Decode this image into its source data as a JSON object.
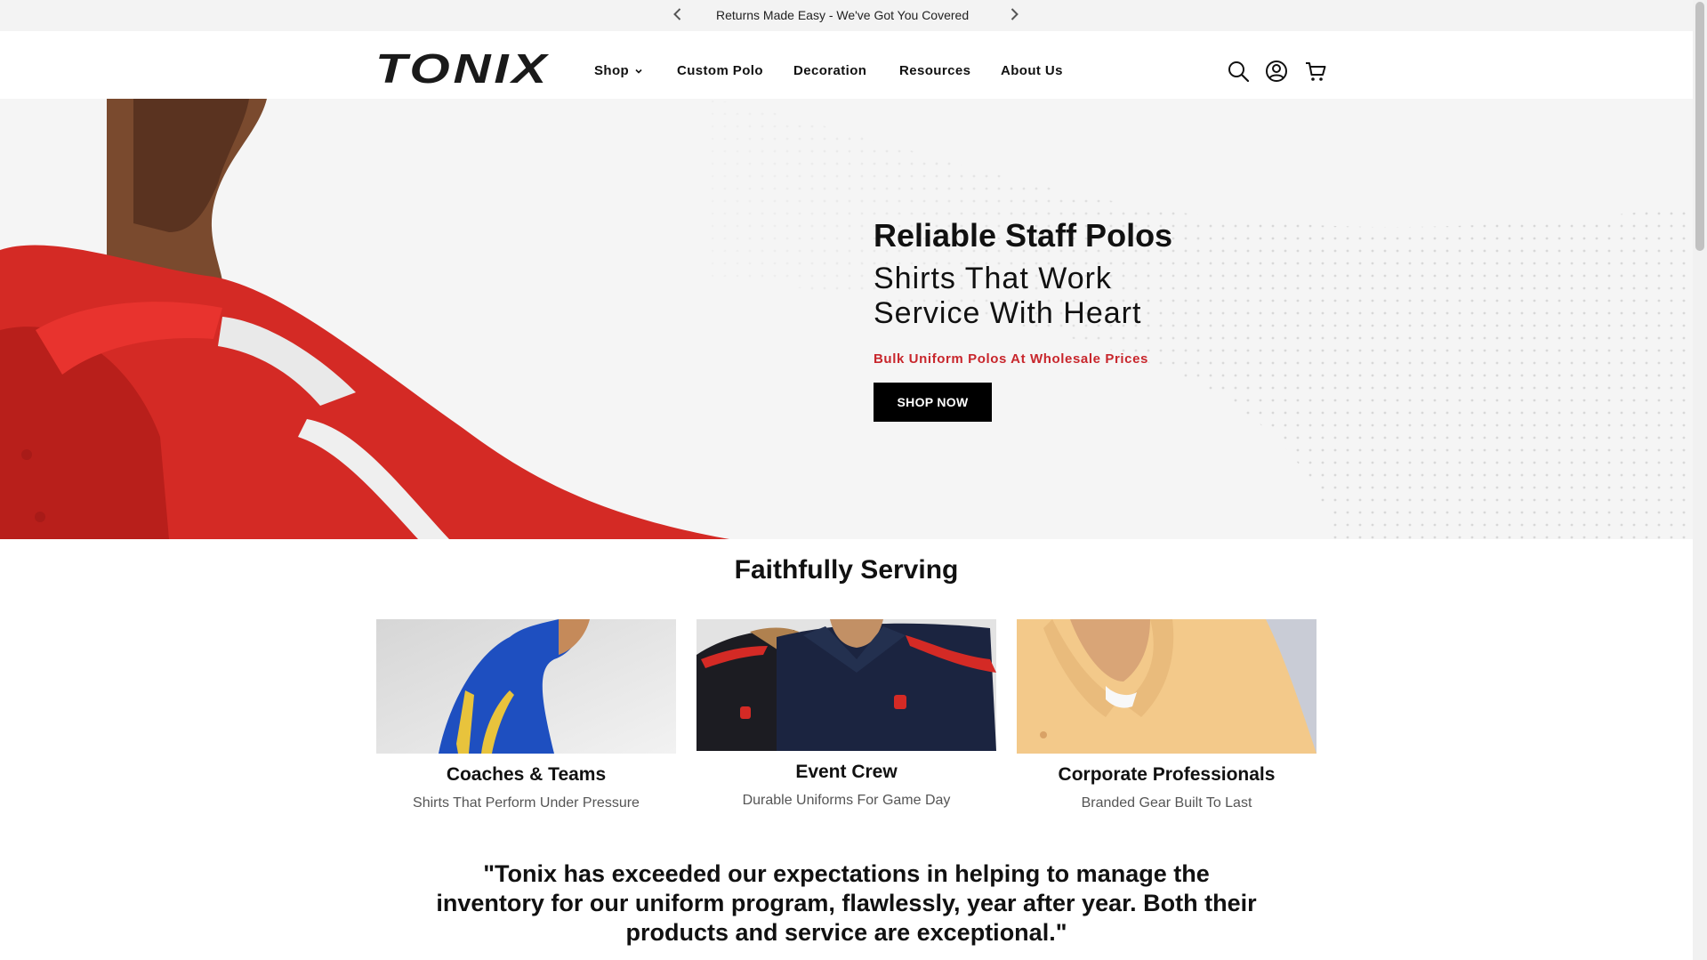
{
  "announcement": {
    "text": "Returns Made Easy - We've Got You Covered"
  },
  "brand": {
    "logo_text": "TONIX"
  },
  "nav": {
    "items": [
      {
        "label": "Shop"
      },
      {
        "label": "Custom Polo"
      },
      {
        "label": "Decoration"
      },
      {
        "label": "Resources"
      },
      {
        "label": "About Us"
      }
    ]
  },
  "icons": {
    "search": "search-icon",
    "account": "account-icon",
    "cart": "cart-icon"
  },
  "hero": {
    "title": "Reliable Staff Polos",
    "line1": "Shirts That Work",
    "line2": "Service With Heart",
    "tagline": "Bulk Uniform Polos At Wholesale Prices",
    "cta": "SHOP NOW"
  },
  "serving": {
    "title": "Faithfully Serving",
    "cards": [
      {
        "name": "Coaches & Teams",
        "subtitle": "Shirts That Perform Under Pressure"
      },
      {
        "name": "Event Crew",
        "subtitle": "Durable Uniforms For Game Day"
      },
      {
        "name": "Corporate Professionals",
        "subtitle": "Branded Gear Built To Last"
      }
    ]
  },
  "testimonial": {
    "quote": "\"Tonix has exceeded our expectations in helping to manage the inventory for our uniform program, flawlessly, year after year. Both their products and service are exceptional.\""
  },
  "colors": {
    "accent": "#c8262c",
    "cta_bg": "#000000",
    "announcement_bg": "#f3f3f3"
  }
}
